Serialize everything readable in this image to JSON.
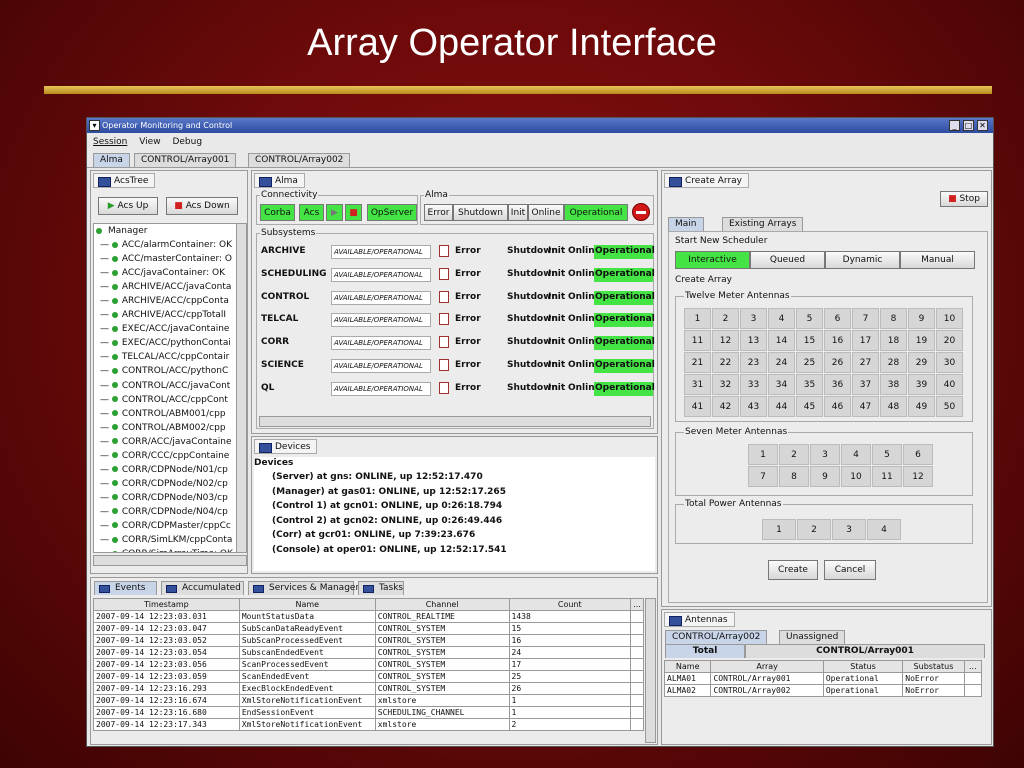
{
  "slide": {
    "title": "Array Operator Interface"
  },
  "window": {
    "title": "Operator Monitoring and Control"
  },
  "menu": [
    "Session",
    "View",
    "Debug"
  ],
  "tabs": [
    "Alma",
    "CONTROL/Array001",
    "CONTROL/Array002"
  ],
  "acstree": {
    "header": "AcsTree",
    "acs_up": "Acs Up",
    "acs_down": "Acs Down",
    "root": "Manager",
    "items": [
      "ACC/alarmContainer: OK",
      "ACC/masterContainer: O",
      "ACC/javaContainer: OK",
      "ARCHIVE/ACC/javaConta",
      "ARCHIVE/ACC/cppConta",
      "ARCHIVE/ACC/cppTotalI",
      "EXEC/ACC/javaContaine",
      "EXEC/ACC/pythonContai",
      "TELCAL/ACC/cppContair",
      "CONTROL/ACC/pythonC",
      "CONTROL/ACC/javaCont",
      "CONTROL/ACC/cppCont",
      "CONTROL/ABM001/cpp",
      "CONTROL/ABM002/cpp",
      "CORR/ACC/javaContaine",
      "CORR/CCC/cppContaine",
      "CORR/CDPNode/N01/cp",
      "CORR/CDPNode/N02/cp",
      "CORR/CDPNode/N03/cp",
      "CORR/CDPNode/N04/cp",
      "CORR/CDPMaster/cppCc",
      "CORR/SimLKM/cppConta",
      "CORR/SimArrayTime: OK"
    ]
  },
  "alma": {
    "header": "Alma",
    "connectivity_label": "Connectivity",
    "corba": "Corba",
    "acs": "Acs",
    "opserver": "OpServer",
    "alma_label": "Alma",
    "states": [
      "Error",
      "Shutdown",
      "Init",
      "Online",
      "Operational"
    ],
    "subsystems_label": "Subsystems",
    "subsystems": [
      {
        "name": "ARCHIVE",
        "status": "AVAILABLE/OPERATIONAL"
      },
      {
        "name": "SCHEDULING",
        "status": "AVAILABLE/OPERATIONAL"
      },
      {
        "name": "CONTROL",
        "status": "AVAILABLE/OPERATIONAL"
      },
      {
        "name": "TELCAL",
        "status": "AVAILABLE/OPERATIONAL"
      },
      {
        "name": "CORR",
        "status": "AVAILABLE/OPERATIONAL"
      },
      {
        "name": "SCIENCE",
        "status": "AVAILABLE/OPERATIONAL"
      },
      {
        "name": "QL",
        "status": "AVAILABLE/OPERATIONAL"
      }
    ]
  },
  "devices": {
    "header": "Devices",
    "root": "Devices",
    "lines": [
      "(Server)  at gns: ONLINE, up 12:52:17.470",
      "(Manager)  at gas01: ONLINE, up 12:52:17.265",
      "(Control 1)  at gcn01: ONLINE, up 0:26:18.794",
      "(Control 2)  at gcn02: ONLINE, up 0:26:49.446",
      "(Corr)  at gcr01: ONLINE, up 7:39:23.676",
      "(Console)  at oper01: ONLINE, up 12:52:17.541"
    ]
  },
  "events": {
    "tabs": [
      "Events",
      "Accumulated",
      "Services & Manager",
      "Tasks"
    ],
    "columns": [
      "Timestamp",
      "Name",
      "Channel",
      "Count",
      "..."
    ],
    "rows": [
      [
        "2007-09-14 12:23:03.031",
        "MountStatusData",
        "CONTROL_REALTIME",
        "1438"
      ],
      [
        "2007-09-14 12:23:03.047",
        "SubScanDataReadyEvent",
        "CONTROL_SYSTEM",
        "15"
      ],
      [
        "2007-09-14 12:23:03.052",
        "SubScanProcessedEvent",
        "CONTROL_SYSTEM",
        "16"
      ],
      [
        "2007-09-14 12:23:03.054",
        "SubscanEndedEvent",
        "CONTROL_SYSTEM",
        "24"
      ],
      [
        "2007-09-14 12:23:03.056",
        "ScanProcessedEvent",
        "CONTROL_SYSTEM",
        "17"
      ],
      [
        "2007-09-14 12:23:03.059",
        "ScanEndedEvent",
        "CONTROL_SYSTEM",
        "25"
      ],
      [
        "2007-09-14 12:23:16.293",
        "ExecBlockEndedEvent",
        "CONTROL_SYSTEM",
        "26"
      ],
      [
        "2007-09-14 12:23:16.674",
        "XmlStoreNotificationEvent",
        "xmlstore",
        "1"
      ],
      [
        "2007-09-14 12:23:16.680",
        "EndSessionEvent",
        "SCHEDULING_CHANNEL",
        "1"
      ],
      [
        "2007-09-14 12:23:17.343",
        "XmlStoreNotificationEvent",
        "xmlstore",
        "2"
      ]
    ]
  },
  "create_array": {
    "header": "Create Array",
    "stop": "Stop",
    "tabs": [
      "Main",
      "Existing Arrays"
    ],
    "scheduler_label": "Start New Scheduler",
    "scheduler_modes": [
      "Interactive",
      "Queued",
      "Dynamic",
      "Manual"
    ],
    "create_label": "Create Array",
    "twelve_label": "Twelve Meter Antennas",
    "twelve_count": 50,
    "seven_label": "Seven Meter Antennas",
    "seven_count": 12,
    "tp_label": "Total Power Antennas",
    "tp_count": 4,
    "create_btn": "Create",
    "cancel_btn": "Cancel"
  },
  "antennas": {
    "header": "Antennas",
    "tabs": [
      "CONTROL/Array002",
      "Unassigned"
    ],
    "subtabs": [
      "Total",
      "CONTROL/Array001"
    ],
    "columns": [
      "Name",
      "Array",
      "Status",
      "Substatus",
      "..."
    ],
    "rows": [
      [
        "ALMA01",
        "CONTROL/Array001",
        "Operational",
        "NoError"
      ],
      [
        "ALMA02",
        "CONTROL/Array002",
        "Operational",
        "NoError"
      ]
    ]
  },
  "colors": {
    "operational": "#44e444",
    "title_rule": "#d4a63a",
    "selected_tab": "#c8d4e8"
  }
}
